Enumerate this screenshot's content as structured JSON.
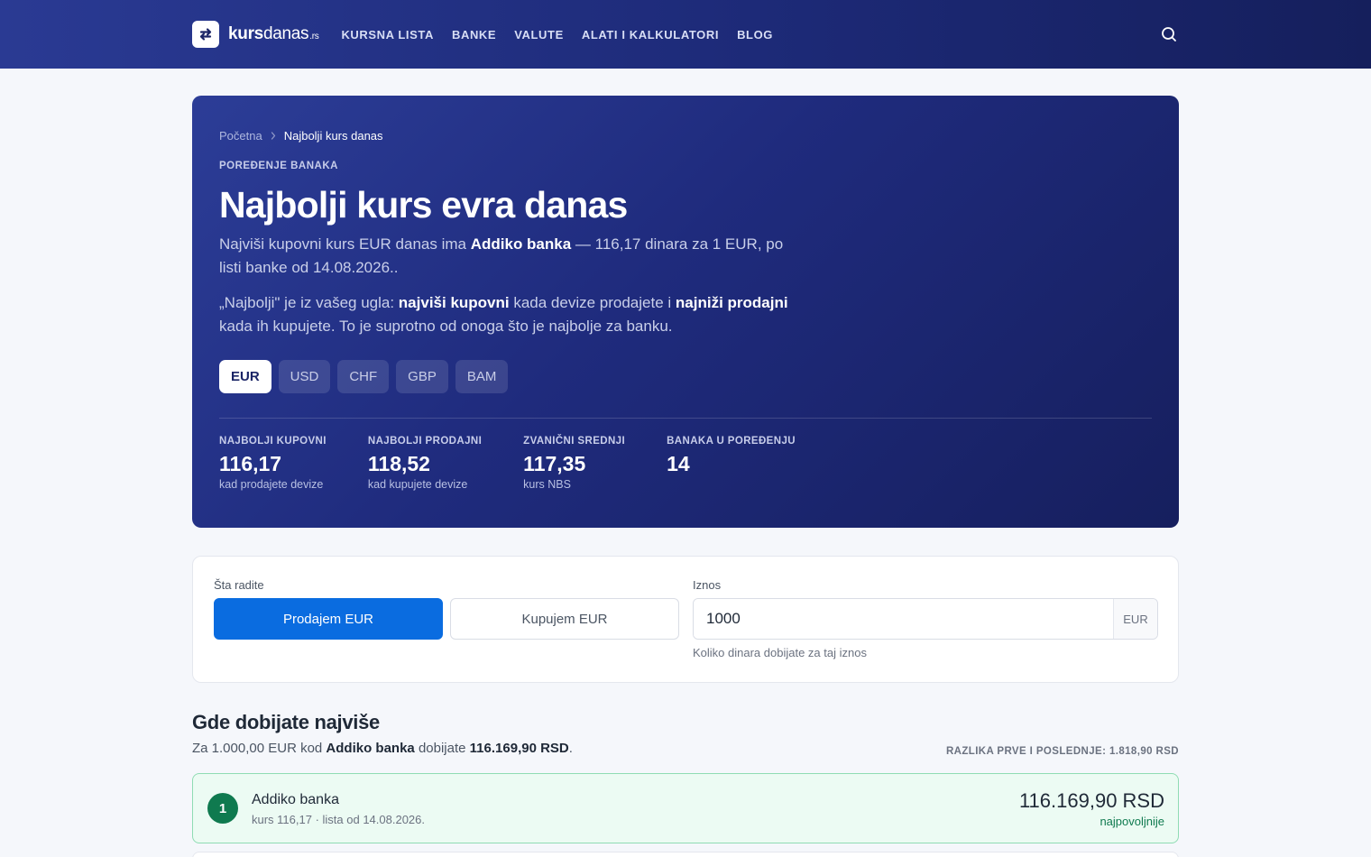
{
  "nav": {
    "logo": {
      "main": "kurs",
      "light": "danas",
      "tld": ".rs"
    },
    "items": [
      "KURSNA LISTA",
      "BANKE",
      "VALUTE",
      "ALATI I KALKULATORI",
      "BLOG"
    ],
    "icons": {
      "logo": "exchange-arrows-icon",
      "search": "search-icon"
    }
  },
  "hero": {
    "breadcrumb": {
      "home": "Početna",
      "current": "Najbolji kurs danas"
    },
    "kicker": "POREĐENJE BANAKA",
    "title": "Najbolji kurs evra danas",
    "p1": {
      "pre": "Najviši kupovni kurs EUR danas ima ",
      "bank": "Addiko banka",
      "post": " — 116,17 dinara za 1 EUR, po listi banke od 14.08.2026.."
    },
    "p2": {
      "a": "„Najbolji\" je iz vašeg ugla: ",
      "b": "najviši kupovni",
      "c": " kada devize prodajete i ",
      "d": "najniži prodajni",
      "e": " kada ih kupujete. To je suprotno od onoga što je najbolje za banku."
    },
    "currencies": [
      "EUR",
      "USD",
      "CHF",
      "GBP",
      "BAM"
    ],
    "active_currency": "EUR",
    "stats": [
      {
        "label": "NAJBOLJI KUPOVNI",
        "value": "116,17",
        "sub": "kad prodajete devize"
      },
      {
        "label": "NAJBOLJI PRODAJNI",
        "value": "118,52",
        "sub": "kad kupujete devize"
      },
      {
        "label": "ZVANIČNI SREDNJI",
        "value": "117,35",
        "sub": "kurs NBS"
      },
      {
        "label": "BANAKA U POREĐENJU",
        "value": "14",
        "sub": ""
      }
    ]
  },
  "calc": {
    "action_label": "Šta radite",
    "sell_label": "Prodajem EUR",
    "buy_label": "Kupujem EUR",
    "amount_label": "Iznos",
    "amount_value": "1000",
    "amount_unit": "EUR",
    "amount_hint": "Koliko dinara dobijate za taj iznos"
  },
  "results": {
    "title": "Gde dobijate najviše",
    "summary": {
      "pre": "Za 1.000,00 EUR kod ",
      "bank": "Addiko banka",
      "mid": " dobijate ",
      "amount": "116.169,90 RSD",
      "post": "."
    },
    "diff": "RAZLIKA PRVE I POSLEDNJE: 1.818,90 RSD",
    "rows": [
      {
        "rank": "1",
        "bank": "Addiko banka",
        "meta": "kurs 116,17 · lista od 14.08.2026.",
        "amount": "116.169,90 RSD",
        "tag": "najpovoljnije"
      }
    ]
  },
  "colors": {
    "hero_bg": "#1f2b7d",
    "accent_blue": "#0a6ce0",
    "best_green": "#0f7a4f",
    "best_row_bg": "#ecfbf3"
  }
}
